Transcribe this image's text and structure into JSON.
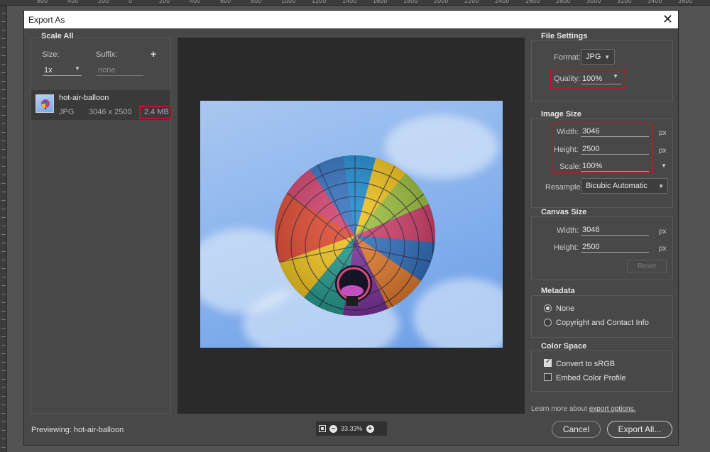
{
  "app": {
    "ruler_ticks": [
      "600",
      "400",
      "200",
      "0",
      "200",
      "400",
      "600",
      "800",
      "1000",
      "1200",
      "1400",
      "1600",
      "1800",
      "2000",
      "2200",
      "2400",
      "2600",
      "2800",
      "3000",
      "3200",
      "3400",
      "3600"
    ]
  },
  "dialog": {
    "title": "Export As",
    "close_glyph": "✕"
  },
  "scale_all": {
    "title": "Scale All",
    "size_label": "Size:",
    "suffix_label": "Suffix:",
    "add_glyph": "+",
    "size_value": "1x",
    "suffix_placeholder": "none"
  },
  "asset": {
    "name": "hot-air-balloon",
    "format": "JPG",
    "dimensions": "3046 x 2500",
    "file_size": "2.4 MB"
  },
  "file_settings": {
    "title": "File Settings",
    "format_label": "Format:",
    "format_value": "JPG",
    "quality_label": "Quality:",
    "quality_value": "100%"
  },
  "image_size": {
    "title": "Image Size",
    "width_label": "Width:",
    "width_value": "3046",
    "height_label": "Height:",
    "height_value": "2500",
    "scale_label": "Scale:",
    "scale_value": "100%",
    "unit": "px",
    "resample_label": "Resample:",
    "resample_value": "Bicubic Automatic"
  },
  "canvas_size": {
    "title": "Canvas Size",
    "width_label": "Width:",
    "width_value": "3046",
    "height_label": "Height:",
    "height_value": "2500",
    "unit": "px",
    "reset_label": "Reset"
  },
  "metadata": {
    "title": "Metadata",
    "options": [
      "None",
      "Copyright and Contact Info"
    ],
    "selected": "None"
  },
  "color_space": {
    "title": "Color Space",
    "convert_label": "Convert to sRGB",
    "convert_checked": true,
    "embed_label": "Embed Color Profile",
    "embed_checked": false
  },
  "footer": {
    "learn_more_prefix": "Learn more about ",
    "learn_more_link": "export options.",
    "previewing": "Previewing: hot-air-balloon",
    "zoom": "33.33%",
    "cancel_label": "Cancel",
    "export_label": "Export All..."
  },
  "colors": {
    "highlight": "#c8102e",
    "dialog_bg": "#484848",
    "preview_bg": "#2a2a2a"
  }
}
